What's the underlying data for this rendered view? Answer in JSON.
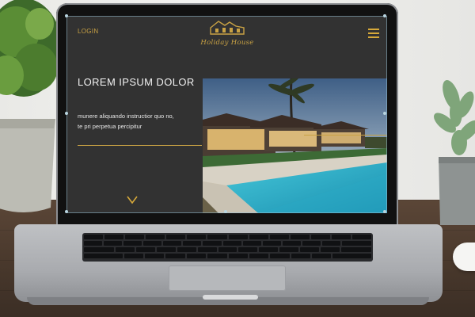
{
  "site": {
    "login_label": "LOGIN",
    "logo_text": "Holiday House",
    "headline": "LOREM IPSUM DOLOR",
    "body_line1": "munere aliquando instructior quo no,",
    "body_line2": "te pri perpetua percipitur"
  },
  "icons": {
    "menu": "hamburger-icon",
    "scroll": "chevron-down-icon",
    "logo": "house-logo-icon"
  },
  "colors": {
    "accent_gold": "#c9a244",
    "screen_bg": "#323232"
  }
}
